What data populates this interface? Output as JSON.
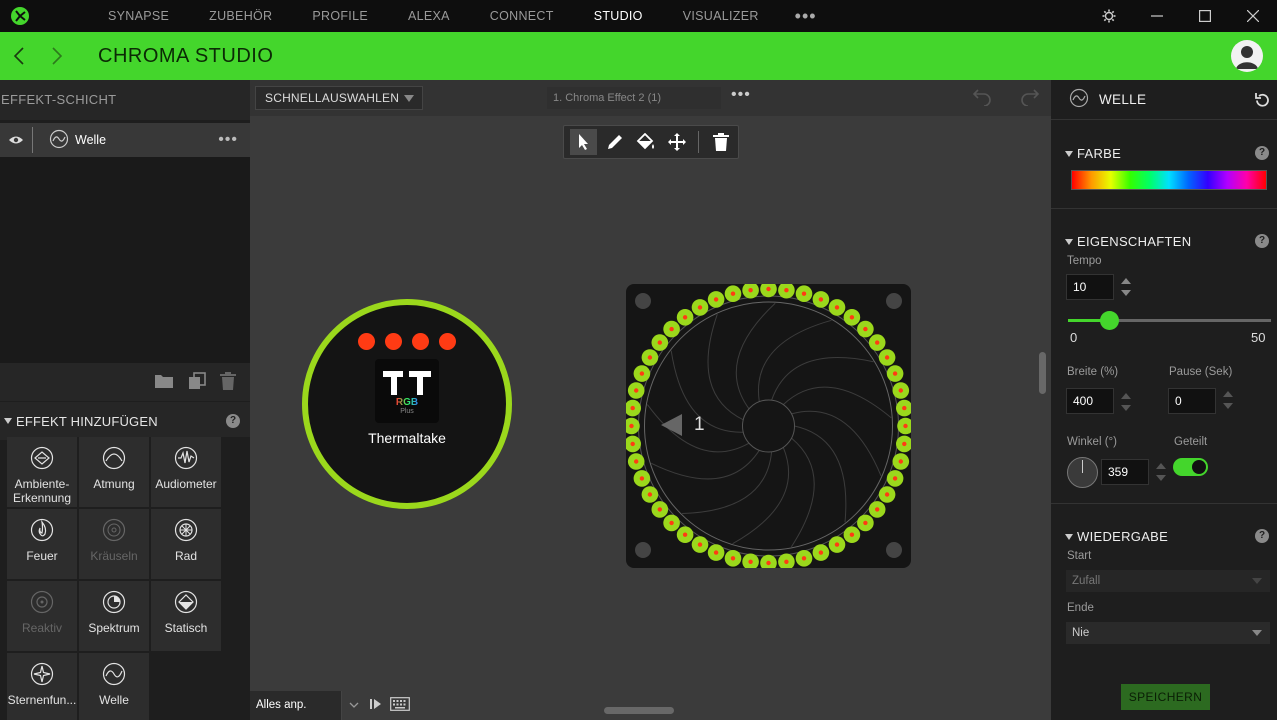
{
  "nav": {
    "items": [
      "SYNAPSE",
      "ZUBEHÖR",
      "PROFILE",
      "ALEXA",
      "CONNECT",
      "STUDIO",
      "VISUALIZER"
    ],
    "active": "STUDIO",
    "more": "•••"
  },
  "header": {
    "title": "CHROMA STUDIO"
  },
  "left": {
    "layer_title": "EFFEKT-SCHICHT",
    "layer_name": "Welle",
    "layer_more": "•••",
    "add_title": "EFFEKT HINZUFÜGEN",
    "help": "?",
    "effects": [
      {
        "label": "Ambiente-Erkennung",
        "icon": "ambient-icon",
        "enabled": true
      },
      {
        "label": "Atmung",
        "icon": "breathing-icon",
        "enabled": true
      },
      {
        "label": "Audiometer",
        "icon": "audiometer-icon",
        "enabled": true
      },
      {
        "label": "Feuer",
        "icon": "fire-icon",
        "enabled": true
      },
      {
        "label": "Kräuseln",
        "icon": "ripple-icon",
        "enabled": false
      },
      {
        "label": "Rad",
        "icon": "wheel-icon",
        "enabled": true
      },
      {
        "label": "Reaktiv",
        "icon": "reactive-icon",
        "enabled": false
      },
      {
        "label": "Spektrum",
        "icon": "spectrum-icon",
        "enabled": true
      },
      {
        "label": "Statisch",
        "icon": "static-icon",
        "enabled": true
      },
      {
        "label": "Sternenfun...",
        "icon": "starlight-icon",
        "enabled": true
      },
      {
        "label": "Welle",
        "icon": "wave-icon",
        "enabled": true
      }
    ]
  },
  "canvas": {
    "quick_select": "SCHNELLAUSWAHLEN",
    "effect_name": "1. Chroma Effect 2 (1)",
    "more": "•••",
    "device_name": "Thermaltake",
    "logo_text": "RGB",
    "logo_sub": "Plus",
    "fan_label": "1",
    "fit": "Alles anp."
  },
  "right": {
    "title": "WELLE",
    "color_section": "FARBE",
    "props_section": "EIGENSCHAFTEN",
    "tempo_label": "Tempo",
    "tempo_value": "10",
    "slider_min": "0",
    "slider_max": "50",
    "slider_value": 10,
    "width_label": "Breite (%)",
    "width_value": "400",
    "pause_label": "Pause (Sek)",
    "pause_value": "0",
    "angle_label": "Winkel (°)",
    "angle_value": "359",
    "split_label": "Geteilt",
    "split_on": true,
    "playback_section": "WIEDERGABE",
    "start_label": "Start",
    "start_value": "Zufall",
    "end_label": "Ende",
    "end_value": "Nie",
    "save": "SPEICHERN",
    "help": "?"
  },
  "colors": {
    "accent": "#44d62c",
    "fan_led": "#9bd81c",
    "led_dot": "#ff3b14"
  }
}
